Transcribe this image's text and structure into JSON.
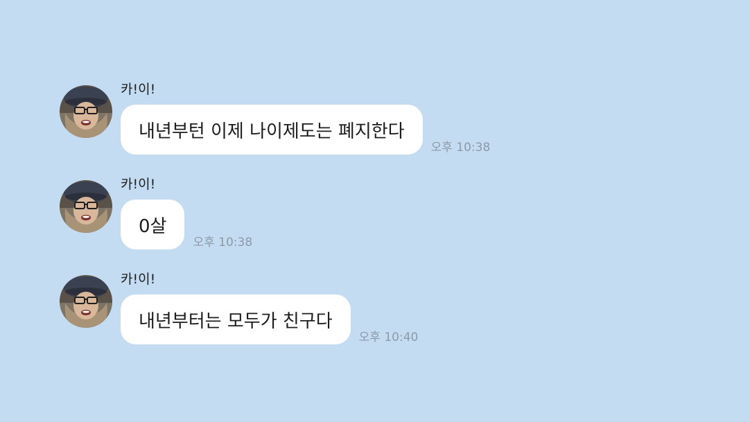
{
  "messages": [
    {
      "sender": "카!이!",
      "text": "내년부턴 이제 나이제도는 폐지한다",
      "time": "오후 10:38"
    },
    {
      "sender": "카!이!",
      "text": "0살",
      "time": "오후 10:38"
    },
    {
      "sender": "카!이!",
      "text": "내년부터는 모두가 친구다",
      "time": "오후 10:40"
    }
  ],
  "colors": {
    "background": "#c4dcf2",
    "bubble": "#ffffff",
    "time_text": "#8c9aa8"
  },
  "icons": {
    "avatar": "profile-photo-avatar"
  }
}
